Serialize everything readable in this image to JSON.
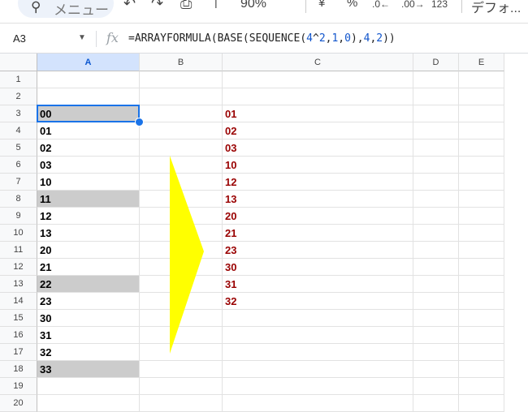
{
  "toolbar": {
    "menu_search_icon": "search-icon",
    "menu_search_text": "メニュー",
    "undo_icon": "↶",
    "redo_icon": "↷",
    "print_icon": "⎙",
    "paint_format_icon": "⊤",
    "zoom": "90%",
    "currency": "¥",
    "percent": "%",
    "decimal_decrease": ".0←",
    "decimal_increase": ".00→",
    "more_formats": "123",
    "font_label": "デフォ..."
  },
  "formula_bar": {
    "name_box": "A3",
    "fx": "fx",
    "formula_parts": [
      "=ARRAYFORMULA(BASE(SEQUENCE(",
      "4",
      "^",
      "2",
      ",",
      "1",
      ",",
      "0",
      "),",
      "4",
      ",",
      "2",
      "))"
    ]
  },
  "columns": [
    "A",
    "B",
    "C",
    "D",
    "E"
  ],
  "rows": [
    "1",
    "2",
    "3",
    "4",
    "5",
    "6",
    "7",
    "8",
    "9",
    "10",
    "11",
    "12",
    "13",
    "14",
    "15",
    "16",
    "17",
    "18",
    "19",
    "20"
  ],
  "column_a": [
    "",
    "",
    "00",
    "01",
    "02",
    "03",
    "10",
    "11",
    "12",
    "13",
    "20",
    "21",
    "22",
    "23",
    "30",
    "31",
    "32",
    "33",
    "",
    ""
  ],
  "column_a_highlighted_rows": [
    3,
    8,
    13,
    18
  ],
  "column_c": [
    "",
    "",
    "01",
    "02",
    "03",
    "10",
    "12",
    "13",
    "20",
    "21",
    "23",
    "30",
    "31",
    "32",
    "",
    "",
    "",
    "",
    "",
    ""
  ],
  "colors": {
    "highlight": "#cccccc",
    "result_text": "#990000",
    "arrow": "#ffff00",
    "selection": "#1a73e8"
  }
}
